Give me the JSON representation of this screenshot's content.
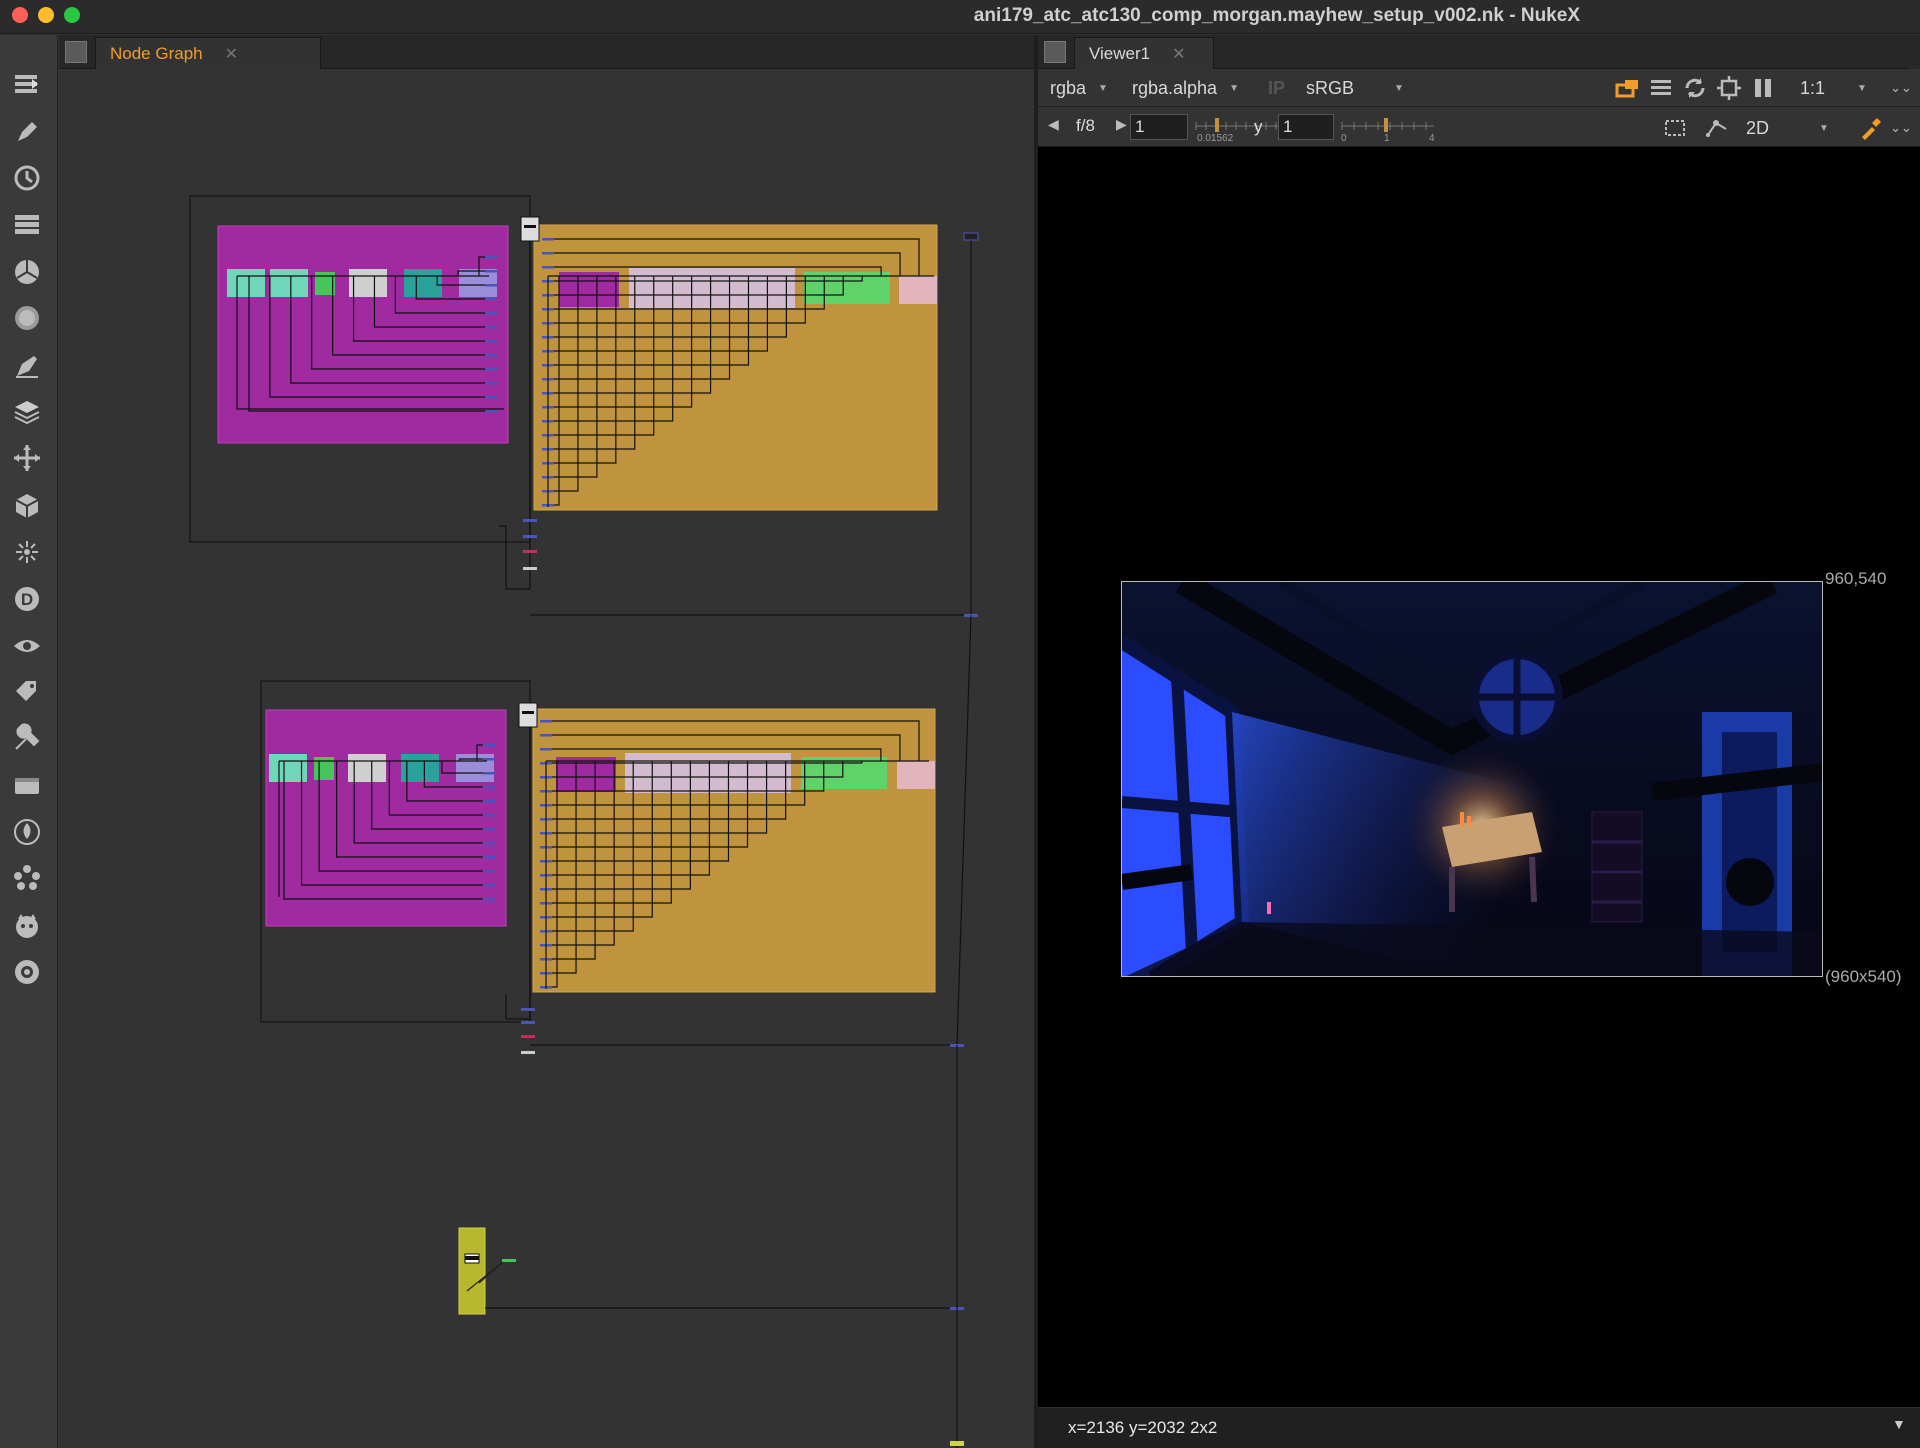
{
  "window": {
    "title": "ani179_atc_atc130_comp_morgan.mayhew_setup_v002.nk - NukeX"
  },
  "toolbar": {
    "items": [
      "image-icon",
      "draw-icon",
      "time-icon",
      "channel-icon",
      "color-icon",
      "filter-icon",
      "keyer-icon",
      "merge-icon",
      "transform-icon",
      "3d-icon",
      "particles-icon",
      "deep-icon",
      "views-icon",
      "metadata-icon",
      "toolsets-icon",
      "other-icon",
      "furnace-icon",
      "cara-vr-icon",
      "ocula-icon",
      "plugins-icon"
    ]
  },
  "node_graph": {
    "tab_label": "Node Graph"
  },
  "viewer": {
    "tab_label": "Viewer1",
    "channels": "rgba",
    "channel_display": "rgba.alpha",
    "ip_label": "IP",
    "colorspace": "sRGB",
    "zoom": "1:1",
    "fstop_label": "f/8",
    "gain_value": "1",
    "gamma_label": "y",
    "gamma_value": "1",
    "view_mode": "2D",
    "gain_ticks": [
      "0.01562"
    ],
    "gamma_ticks": [
      "0",
      "1",
      "4"
    ],
    "format_top_right": "960,540",
    "format_bottom_right": "(960x540)",
    "status_text": "x=2136 y=2032 2x2"
  },
  "colors": {
    "backdrop_magenta": "#a02aa0",
    "backdrop_orange": "#c0943f",
    "accent": "#f39c2a"
  }
}
